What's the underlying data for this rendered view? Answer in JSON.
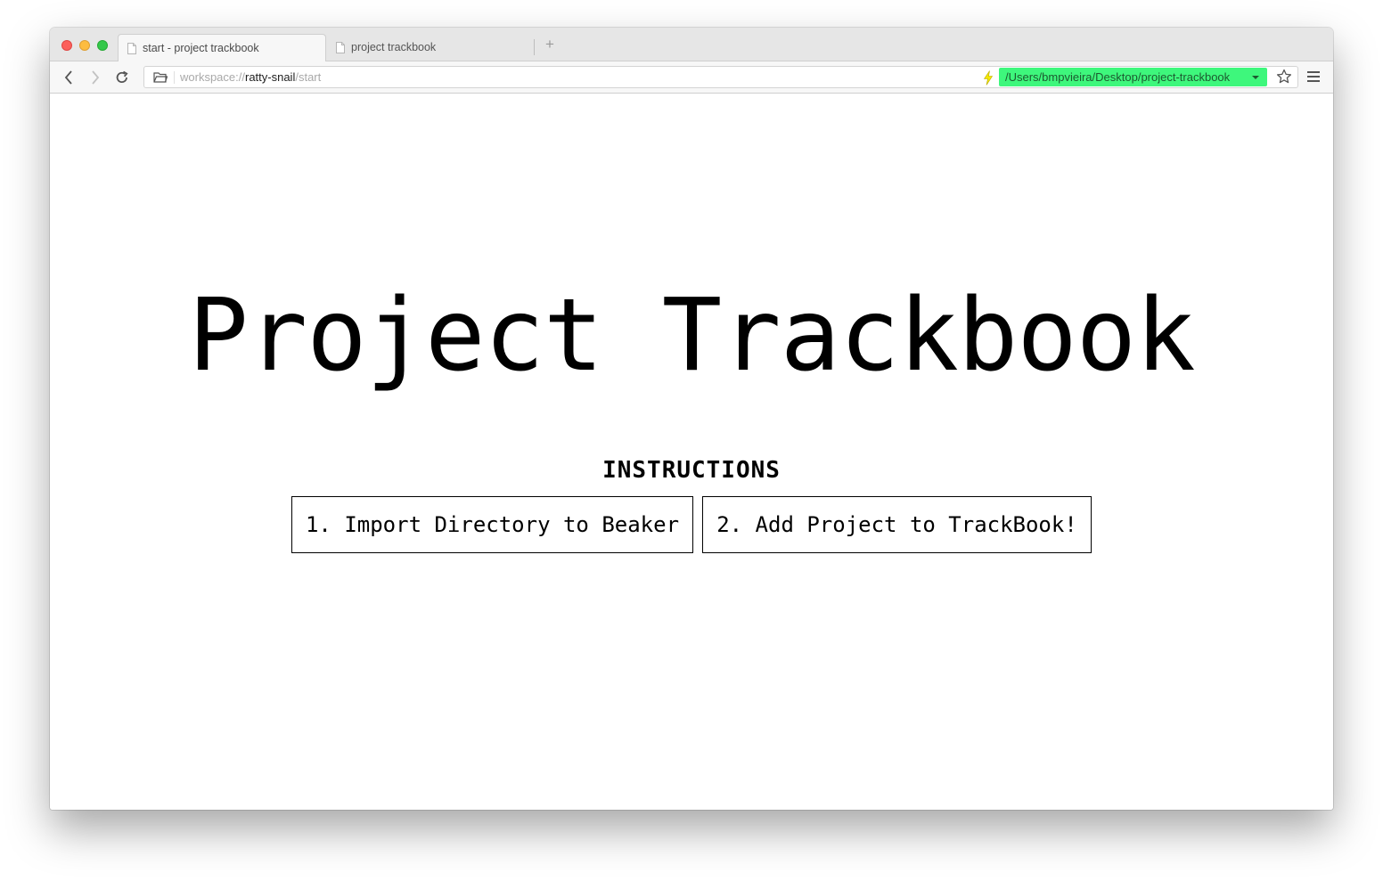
{
  "browser": {
    "tabs": [
      {
        "label": "start - project trackbook",
        "active": true
      },
      {
        "label": "project trackbook",
        "active": false
      }
    ],
    "new_tab_label": "+",
    "url": {
      "scheme": "workspace://",
      "host": "ratty-snail",
      "path": "/start"
    },
    "workspace_path": "/Users/bmpvieira/Desktop/project-trackbook",
    "colors": {
      "path_badge": "#3ef77c",
      "bolt": "#f5e800"
    }
  },
  "page": {
    "title": "Project Trackbook",
    "instructions_heading": "INSTRUCTIONS",
    "steps": [
      {
        "label": "1. Import Directory to Beaker"
      },
      {
        "label": "2. Add Project to TrackBook!"
      }
    ]
  }
}
